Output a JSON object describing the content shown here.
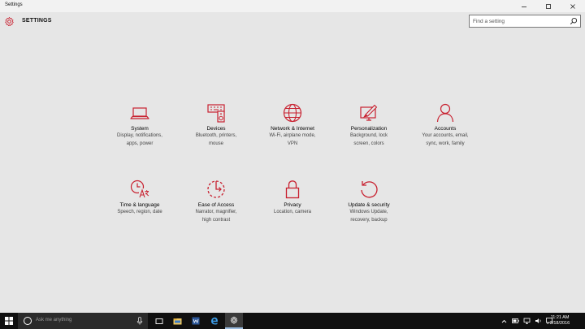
{
  "window": {
    "title": "Settings",
    "controls": [
      "minimize-icon",
      "maximize-icon",
      "close-icon"
    ]
  },
  "header": {
    "title": "SETTINGS",
    "icon": "gear-icon"
  },
  "search": {
    "placeholder": "Find a setting",
    "icon": "search-icon"
  },
  "accent_color": "#c8202f",
  "tiles": [
    {
      "name": "System",
      "desc1": "Display, notifications,",
      "desc2": "apps, power",
      "icon": "laptop-icon"
    },
    {
      "name": "Devices",
      "desc1": "Bluetooth, printers,",
      "desc2": "mouse",
      "icon": "keyboard-speaker-icon"
    },
    {
      "name": "Network & Internet",
      "desc1": "Wi-Fi, airplane mode,",
      "desc2": "VPN",
      "icon": "globe-icon"
    },
    {
      "name": "Personalization",
      "desc1": "Background, lock",
      "desc2": "screen, colors",
      "icon": "paint-screen-icon"
    },
    {
      "name": "Accounts",
      "desc1": "Your accounts, email,",
      "desc2": "sync, work, family",
      "icon": "person-icon"
    },
    {
      "name": "Time & language",
      "desc1": "Speech, region, date",
      "desc2": "",
      "icon": "clock-language-icon"
    },
    {
      "name": "Ease of Access",
      "desc1": "Narrator, magnifier,",
      "desc2": "high contrast",
      "icon": "ease-of-access-icon"
    },
    {
      "name": "Privacy",
      "desc1": "Location, camera",
      "desc2": "",
      "icon": "lock-icon"
    },
    {
      "name": "Update & security",
      "desc1": "Windows Update,",
      "desc2": "recovery, backup",
      "icon": "refresh-icon"
    }
  ],
  "taskbar": {
    "search_text": "Ask me anything",
    "apps": [
      "task-view-icon",
      "file-explorer-icon",
      "word-icon",
      "edge-icon",
      "settings-icon"
    ],
    "active_app": "settings-icon",
    "tray": [
      "chevron-up-icon",
      "battery-icon",
      "network-icon",
      "volume-icon",
      "notification-icon"
    ],
    "time": "11:21 AM",
    "date": "3/18/2016"
  }
}
